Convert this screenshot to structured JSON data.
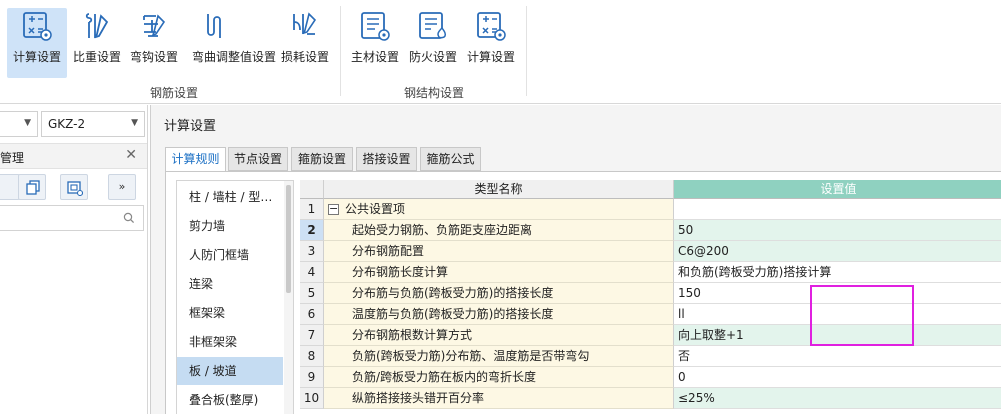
{
  "ribbon": {
    "rebar_buttons": [
      {
        "label": "计算设置",
        "icon": "calc-settings-icon",
        "active": true
      },
      {
        "label": "比重设置",
        "icon": "weight-settings-icon"
      },
      {
        "label": "弯钩设置",
        "icon": "hook-settings-icon"
      },
      {
        "label": "弯曲调整值设置",
        "icon": "bend-adjust-icon"
      },
      {
        "label": "损耗设置",
        "icon": "loss-settings-icon"
      }
    ],
    "steel_buttons": [
      {
        "label": "主材设置",
        "icon": "main-material-icon"
      },
      {
        "label": "防火设置",
        "icon": "fireproof-icon"
      },
      {
        "label": "计算设置",
        "icon": "calc-settings-icon"
      }
    ],
    "group_rebar": "钢筋设置",
    "group_steel": "钢结构设置"
  },
  "left_panel": {
    "dropdown2_value": "GKZ-2",
    "title": "管理",
    "tool_more": "»"
  },
  "dialog": {
    "title": "计算设置",
    "tabs": [
      "计算规则",
      "节点设置",
      "箍筋设置",
      "搭接设置",
      "箍筋公式"
    ],
    "active_tab": 0,
    "categories": [
      "柱 / 墙柱 / 型…",
      "剪力墙",
      "人防门框墙",
      "连梁",
      "框架梁",
      "非框架梁",
      "板 / 坡道",
      "叠合板(整厚)"
    ],
    "selected_category": 6,
    "grid": {
      "col_name": "类型名称",
      "col_value": "设置值",
      "current_row": 2,
      "rows": [
        {
          "num": "1",
          "name": "公共设置项",
          "value": "",
          "group": true
        },
        {
          "num": "2",
          "name": "起始受力钢筋、负筋距支座边距离",
          "value": "50"
        },
        {
          "num": "3",
          "name": "分布钢筋配置",
          "value": "C6@200"
        },
        {
          "num": "4",
          "name": "分布钢筋长度计算",
          "value": "和负筋(跨板受力筋)搭接计算"
        },
        {
          "num": "5",
          "name": "分布筋与负筋(跨板受力筋)的搭接长度",
          "value": "150"
        },
        {
          "num": "6",
          "name": "温度筋与负筋(跨板受力筋)的搭接长度",
          "value": "ll"
        },
        {
          "num": "7",
          "name": "分布钢筋根数计算方式",
          "value": "向上取整+1"
        },
        {
          "num": "8",
          "name": "负筋(跨板受力筋)分布筋、温度筋是否带弯勾",
          "value": "否"
        },
        {
          "num": "9",
          "name": "负筋/跨板受力筋在板内的弯折长度",
          "value": "0"
        },
        {
          "num": "10",
          "name": "纵筋搭接接头错开百分率",
          "value": "≤25%"
        }
      ]
    }
  },
  "colors": {
    "accent": "#1a6fc4",
    "name_cell_bg": "#fdf8e4",
    "value_highlight_bg": "#e3f4ec",
    "value_header_bg": "#8fd1c0",
    "selected_bg": "#c5dcf2",
    "annotation": "#e020e0"
  }
}
